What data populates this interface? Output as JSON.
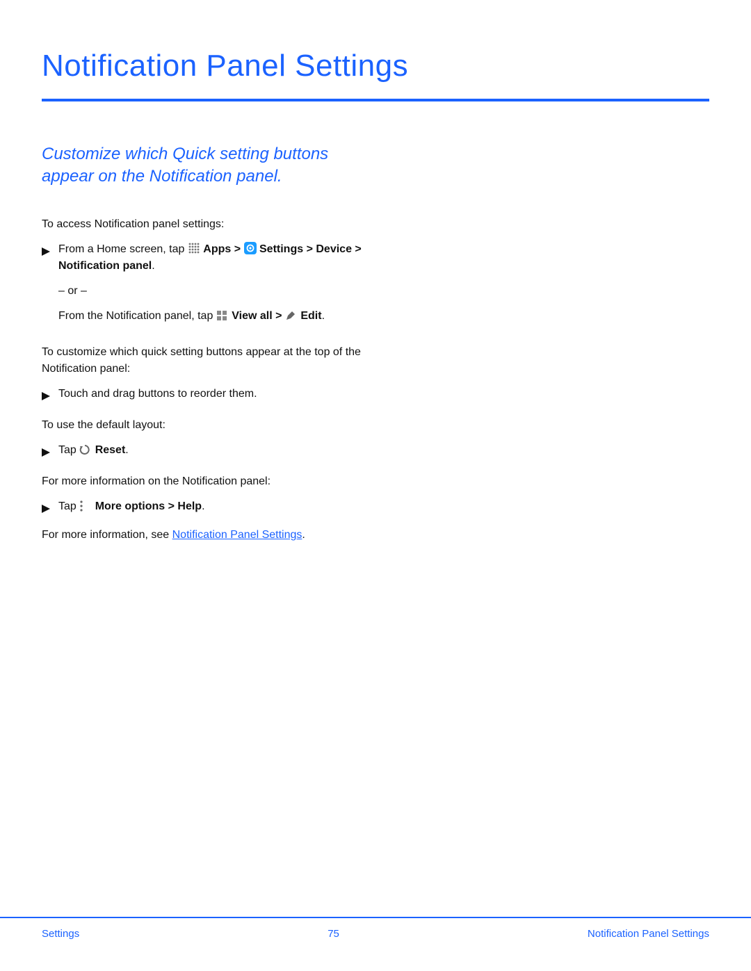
{
  "title": "Notification Panel Settings",
  "intro": "Customize which Quick setting buttons appear on the Notification panel.",
  "section1_lead": "To access Notification panel settings:",
  "step1": {
    "pre": "From a Home screen, tap ",
    "apps_label": "Apps",
    "gt1": " > ",
    "settings_label": "Settings",
    "cont": " > Device > Notification panel",
    "period": "."
  },
  "or_text": "– or –",
  "step1b": {
    "pre": "From the Notification panel, tap ",
    "viewall_label": "View all",
    "gt": " > ",
    "edit_label": "Edit",
    "period": "."
  },
  "section2_lead": "To customize which quick setting buttons appear at the top of the Notification panel:",
  "step2": "Touch and drag buttons to reorder them.",
  "section3_lead": "To use the default layout:",
  "step3": {
    "pre": "Tap ",
    "reset_label": "Reset",
    "period": "."
  },
  "section4_lead": "For more information on the Notification panel:",
  "step4": {
    "pre": "Tap ",
    "more_label": "More options",
    "gt": " > ",
    "help_label": "Help",
    "period": "."
  },
  "moreinfo_pre": "For more information, see ",
  "moreinfo_link": "Notification Panel Settings",
  "moreinfo_post": ".",
  "footer": {
    "left": "Settings",
    "page": "75",
    "right": "Notification Panel Settings"
  }
}
